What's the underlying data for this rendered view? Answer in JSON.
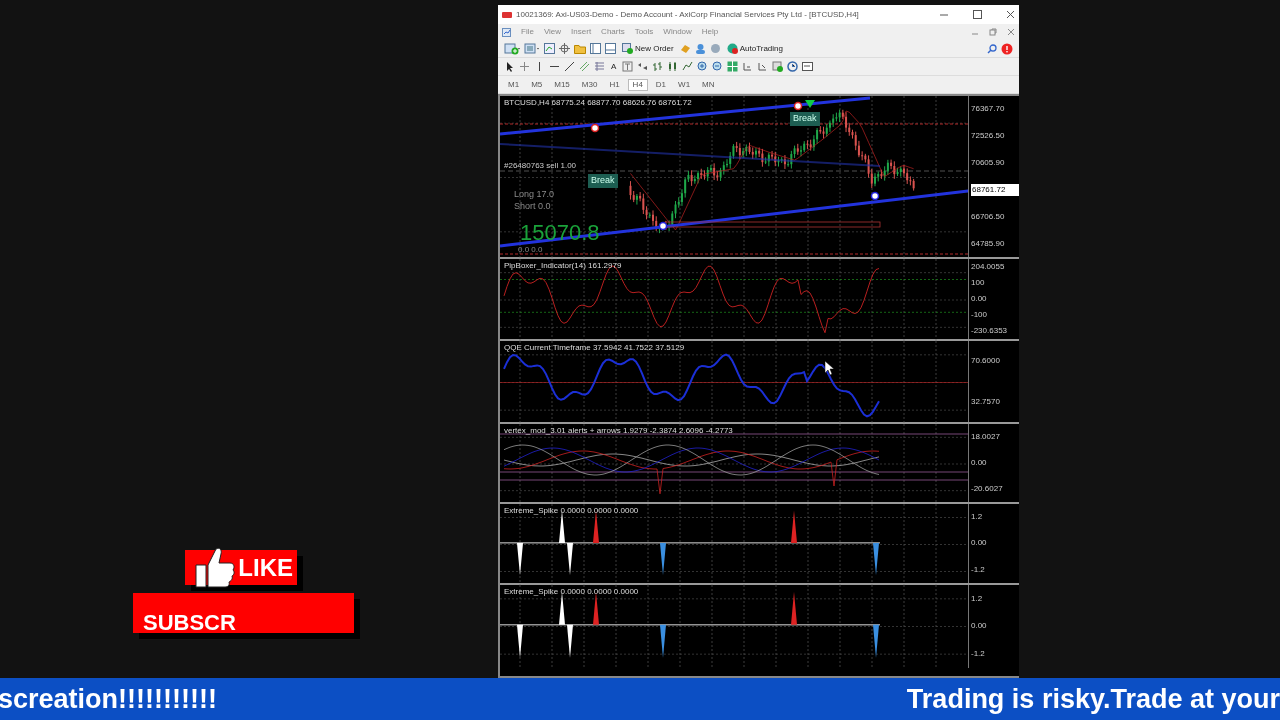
{
  "window": {
    "title": "10021369: Axi-US03-Demo - Demo Account - AxiCorp Financial Services Pty Ltd - [BTCUSD,H4]"
  },
  "menu": [
    "File",
    "View",
    "Insert",
    "Charts",
    "Tools",
    "Window",
    "Help"
  ],
  "toolbar": {
    "new_order": "New Order",
    "auto_trading": "AutoTrading",
    "text_tool": "A"
  },
  "timeframes": [
    {
      "label": "M1",
      "selected": false
    },
    {
      "label": "M5",
      "selected": false
    },
    {
      "label": "M15",
      "selected": false
    },
    {
      "label": "M30",
      "selected": false
    },
    {
      "label": "H1",
      "selected": false
    },
    {
      "label": "H4",
      "selected": true
    },
    {
      "label": "D1",
      "selected": false
    },
    {
      "label": "W1",
      "selected": false
    },
    {
      "label": "MN",
      "selected": false
    }
  ],
  "main_chart": {
    "header": "BTCUSD,H4 68775.24 68877.70 68626.76 68761.72",
    "order_line": "#26480763 sell 1.00",
    "break_labels": [
      "Break",
      "Break"
    ],
    "long": "Long  17.0",
    "short": "Short  0.0",
    "big_value": "15070.8",
    "bottom_values": "0.0   0.0",
    "axis": [
      "76367.70",
      "72526.50",
      "70605.90",
      "66706.50",
      "64785.90"
    ],
    "current_price": "68761.72"
  },
  "indicators": [
    {
      "kind": "pip",
      "title": "PipBoxer_Indicator(14) 161.2979",
      "axis": [
        "204.0055",
        "100",
        "0.00",
        "-100",
        "-230.6353"
      ]
    },
    {
      "kind": "qqe",
      "title": "QQE Current Timeframe 37.5942 41.7522 37.5129",
      "axis": [
        "70.6000",
        "32.7570"
      ]
    },
    {
      "kind": "vertex",
      "title": "vertex_mod_3.01 alerts + arrows 1.9279 -2.3874 2.6096 -4.2773",
      "axis": [
        "18.0027",
        "0.00",
        "-20.6027"
      ]
    },
    {
      "kind": "spike",
      "title": "Extreme_Spike 0.0000 0.0000 0.0000",
      "axis": [
        "1.2",
        "0.00",
        "-1.2"
      ]
    },
    {
      "kind": "spike",
      "title": "Extreme_Spike 0.0000 0.0000 0.0000",
      "axis": [
        "1.2",
        "0.00",
        "-1.2"
      ]
    }
  ],
  "overlay": {
    "like": "LIKE",
    "subscribe": "SUBSCR"
  },
  "ticker": [
    "screation!!!!!!!!!!!",
    "Trading is risky.Trade at your"
  ]
}
